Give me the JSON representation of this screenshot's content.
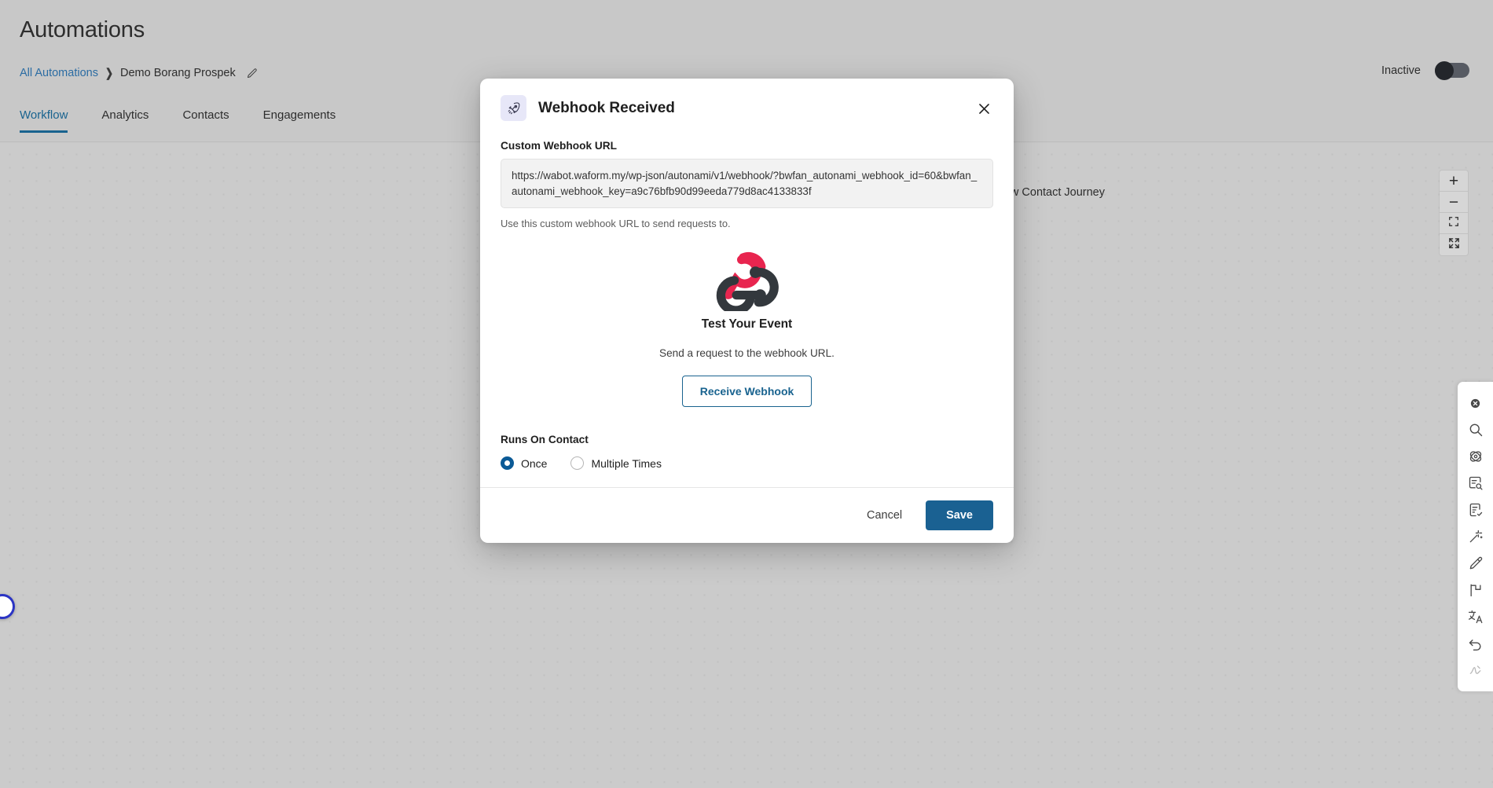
{
  "header": {
    "title": "Automations",
    "breadcrumb": {
      "root_label": "All Automations",
      "separator": "❯",
      "current_label": "Demo Borang Prospek",
      "edit_icon": "pencil-icon"
    },
    "status": {
      "label": "Inactive",
      "toggle_on": false
    }
  },
  "tabs": [
    {
      "label": "Workflow",
      "active": true
    },
    {
      "label": "Analytics",
      "active": false
    },
    {
      "label": "Contacts",
      "active": false
    },
    {
      "label": "Engagements",
      "active": false
    }
  ],
  "canvas": {
    "journey_button": {
      "label": "View Contact Journey",
      "icon": "branch-journey-icon"
    },
    "zoom_controls": [
      {
        "name": "zoom-in",
        "glyph": "+"
      },
      {
        "name": "zoom-out",
        "glyph": "−"
      },
      {
        "name": "fit-view",
        "glyph": "fit-icon"
      },
      {
        "name": "fullscreen",
        "glyph": "expand-icon"
      }
    ],
    "corner_badge": "loading-badge"
  },
  "right_toolbar": [
    {
      "name": "close-circle-icon",
      "dim": false
    },
    {
      "name": "search-icon",
      "dim": false
    },
    {
      "name": "atom-scan-icon",
      "dim": false
    },
    {
      "name": "document-search-icon",
      "dim": false
    },
    {
      "name": "document-check-icon",
      "dim": false
    },
    {
      "name": "magic-wand-icon",
      "dim": false
    },
    {
      "name": "pencil-edit-icon",
      "dim": false
    },
    {
      "name": "flag-icon",
      "dim": false
    },
    {
      "name": "translate-icon",
      "dim": false
    },
    {
      "name": "undo-icon",
      "dim": false
    },
    {
      "name": "signature-icon",
      "dim": true
    }
  ],
  "modal": {
    "icon": "rocket-icon",
    "title": "Webhook Received",
    "close_icon": "close-icon",
    "url_field": {
      "label": "Custom Webhook URL",
      "value": "https://wabot.waform.my/wp-json/autonami/v1/webhook/?bwfan_autonami_webhook_id=60&bwfan_autonami_webhook_key=a9c76bfb90d99eeda779d8ac4133833f",
      "helper": "Use this custom webhook URL to send requests to."
    },
    "test_event": {
      "logo": "webhook-logo",
      "title": "Test Your Event",
      "subtitle": "Send a request to the webhook URL.",
      "button_label": "Receive Webhook"
    },
    "runs_on_contact": {
      "label": "Runs On Contact",
      "options": [
        {
          "label": "Once",
          "selected": true
        },
        {
          "label": "Multiple Times",
          "selected": false
        }
      ]
    },
    "footer": {
      "cancel_label": "Cancel",
      "save_label": "Save"
    }
  },
  "colors": {
    "accent": "#19638f",
    "save_button": "#1a6192",
    "link": "#2b6ca3",
    "webhook_pink": "#e8254f",
    "webhook_dark": "#33383d",
    "canvas_bg": "#cbcbcb"
  }
}
